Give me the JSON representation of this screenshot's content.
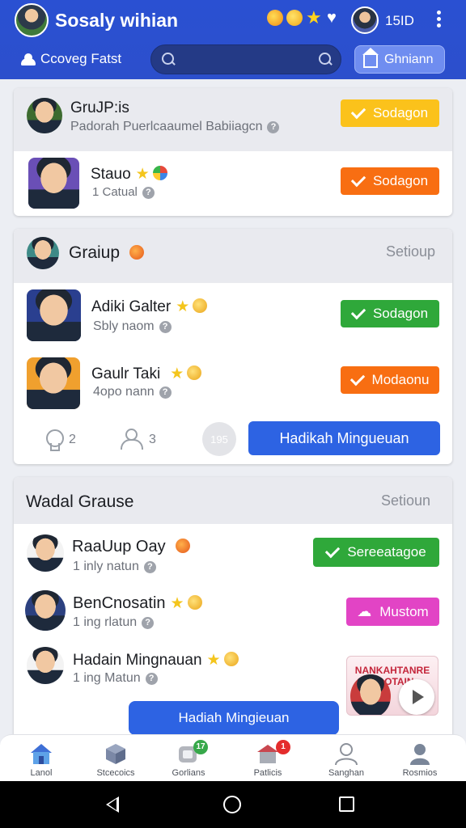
{
  "header": {
    "title": "Sosaly wihian",
    "count": "15ID",
    "sub_label": "Ccoveg Fatst",
    "search_placeholder": "",
    "button_label": "Ghniann"
  },
  "card1": {
    "head": {
      "name": "GruJP:is",
      "meta": "Padorah Puerlcaaumel Babiiagcn",
      "button": "Sodagon"
    },
    "row": {
      "name": "Stauo",
      "meta": "1 Catual",
      "button": "Sodagon"
    }
  },
  "card2": {
    "head": {
      "name": "Graiup",
      "link": "Setioup"
    },
    "rows": [
      {
        "name": "Adiki Galter",
        "meta": "Sbly naom",
        "button": "Sodagon"
      },
      {
        "name": "Gaulr Taki",
        "meta": "4opo nann",
        "button": "Modaonu"
      }
    ],
    "stats": {
      "likes": "2",
      "members": "3",
      "bubble": "195"
    },
    "action_button": "Hadikah Mingueuan"
  },
  "card3": {
    "head": {
      "name": "Wadal Grause",
      "link": "Setioun"
    },
    "rows": [
      {
        "name": "RaaUup Oay",
        "meta": "1 inly natun",
        "button": "Sereeatagoe"
      },
      {
        "name": "BenCnosatin",
        "meta": "1 ing rlatun",
        "button": "Mustom"
      },
      {
        "name": "Hadain Mingnauan",
        "meta": "1 ing Matun"
      }
    ],
    "thumb_text": "NANKAHTANRE SAOTAIN",
    "action_button": "Hadiah Mingieuan"
  },
  "bottom_nav": [
    {
      "label": "Lanol",
      "icon": "home-icon"
    },
    {
      "label": "Stcecoics",
      "icon": "box-icon"
    },
    {
      "label": "Gorlians",
      "icon": "chat-icon",
      "badge": "17"
    },
    {
      "label": "Patlicis",
      "icon": "store-icon",
      "badge": "1"
    },
    {
      "label": "Sanghan",
      "icon": "profile-icon"
    },
    {
      "label": "Rosmios",
      "icon": "account-icon"
    }
  ],
  "colors": {
    "header_blue": "#2c4fcc",
    "yellow": "#fbc21b",
    "orange": "#f86e12",
    "green": "#2fa83a",
    "magenta": "#e244c5",
    "action_blue": "#2d63e3"
  }
}
